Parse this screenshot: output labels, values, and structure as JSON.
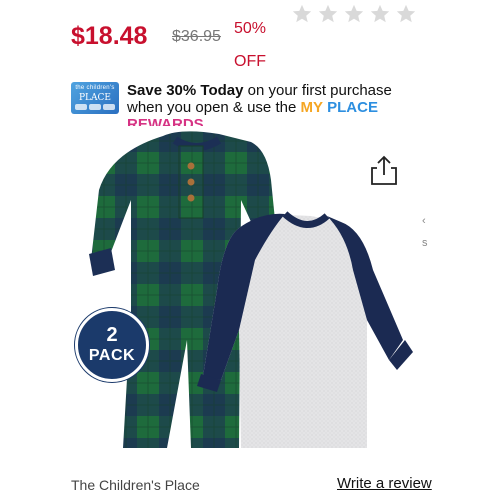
{
  "price": {
    "sale": "$18.48",
    "original": "$36.95",
    "discount": "50% OFF"
  },
  "rating": {
    "stars_filled": 0,
    "stars_total": 5
  },
  "promo": {
    "badge_brand": "the children's",
    "badge_name": "PLACE",
    "headline": "Save 30% Today",
    "text": " on your first purchase when you open & use the ",
    "reward_word_1": "MY",
    "reward_word_2": "PLACE",
    "reward_word_3": "REWARDS"
  },
  "product": {
    "pack_number": "2",
    "pack_label": "PACK",
    "image_alt": "Two baby one-piece romper pajamas: green and navy buffalo plaid henley romper and heather gray with navy raglan sleeves romper"
  },
  "carousel_peek_text": "‹ s",
  "brand": "The Children's Place",
  "review_link": "Write a review",
  "colors": {
    "sale_red": "#c8102e",
    "navy": "#1b3a6b",
    "plaid_green": "#1e6b3c",
    "plaid_navy": "#1c2f55",
    "raglan_gray": "#e4e4e6"
  },
  "icons": {
    "star": "star-outline-icon",
    "share": "share-icon"
  }
}
